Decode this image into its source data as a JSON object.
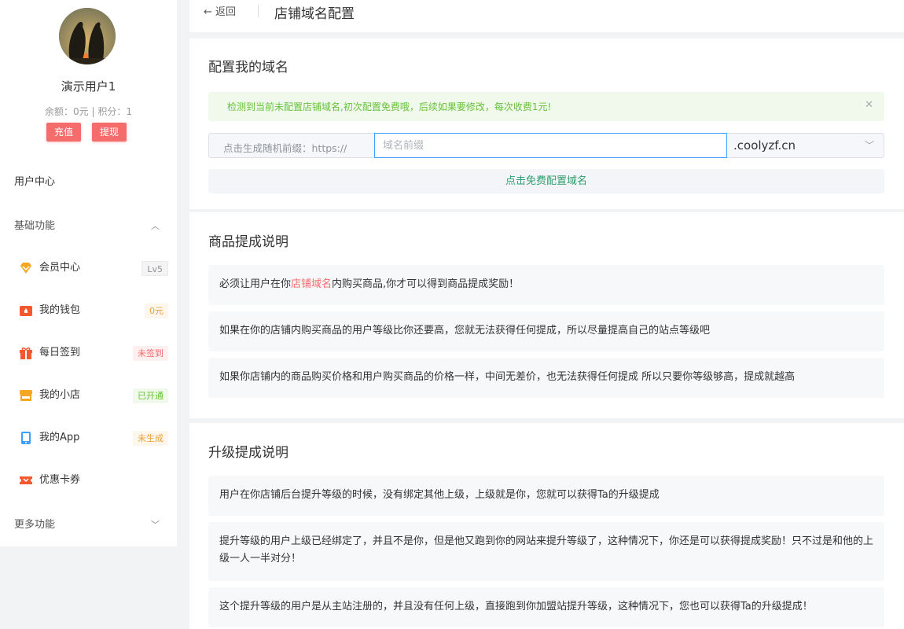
{
  "sidebar": {
    "username": "演示用户1",
    "balance": "余额：0元 | 积分：1",
    "recharge_label": "充值",
    "withdraw_label": "提现",
    "user_center": "用户中心",
    "basic_group": "基础功能",
    "more_group": "更多功能",
    "items": [
      {
        "label": "会员中心",
        "badge": "Lv5",
        "icon": "diamond-icon",
        "color": "#f5a623"
      },
      {
        "label": "我的钱包",
        "badge": "0元",
        "icon": "wallet-icon",
        "color": "#f5572f"
      },
      {
        "label": "每日签到",
        "badge": "未签到",
        "icon": "gift-icon",
        "color": "#f5572f"
      },
      {
        "label": "我的小店",
        "badge": "已开通",
        "icon": "shop-icon",
        "color": "#f5a623"
      },
      {
        "label": "我的App",
        "badge": "未生成",
        "icon": "phone-icon",
        "color": "#409eff"
      },
      {
        "label": "优惠卡券",
        "badge": "",
        "icon": "coupon-icon",
        "color": "#f5572f"
      }
    ]
  },
  "header": {
    "back_label": "返回",
    "title": "店铺域名配置"
  },
  "config": {
    "title": "配置我的域名",
    "alert": "检测到当前未配置店铺域名,初次配置免费哦，后续如果要修改，每次收费1元!",
    "prefix_label": "点击生成随机前缀：https://",
    "input_placeholder": "域名前缀",
    "input_value": "",
    "suffix": ".coolyzf.cn",
    "submit_label": "点击免费配置域名"
  },
  "commission": {
    "title": "商品提成说明",
    "note1_pre": "必须让用户在你",
    "note1_hl": "店铺域名",
    "note1_post": "内购买商品,你才可以得到商品提成奖励！",
    "note2": "如果在你的店铺内购买商品的用户等级比你还要高，您就无法获得任何提成，所以尽量提高自己的站点等级吧",
    "note3": "如果你店铺内的商品购买价格和用户购买商品的价格一样，中间无差价，也无法获得任何提成 所以只要你等级够高，提成就越高"
  },
  "upgrade": {
    "title": "升级提成说明",
    "note1": "用户在你店铺后台提升等级的时候，没有绑定其他上级，上级就是你，您就可以获得Ta的升级提成",
    "note2": "提升等级的用户上级已经绑定了，并且不是你，但是他又跑到你的网站来提升等级了，这种情况下，你还是可以获得提成奖励！只不过是和他的上级一人一半对分！",
    "note3": "这个提升等级的用户是从主站注册的，并且没有任何上级，直接跑到你加盟站提升等级，这种情况下，您也可以获得Ta的升级提成！"
  }
}
